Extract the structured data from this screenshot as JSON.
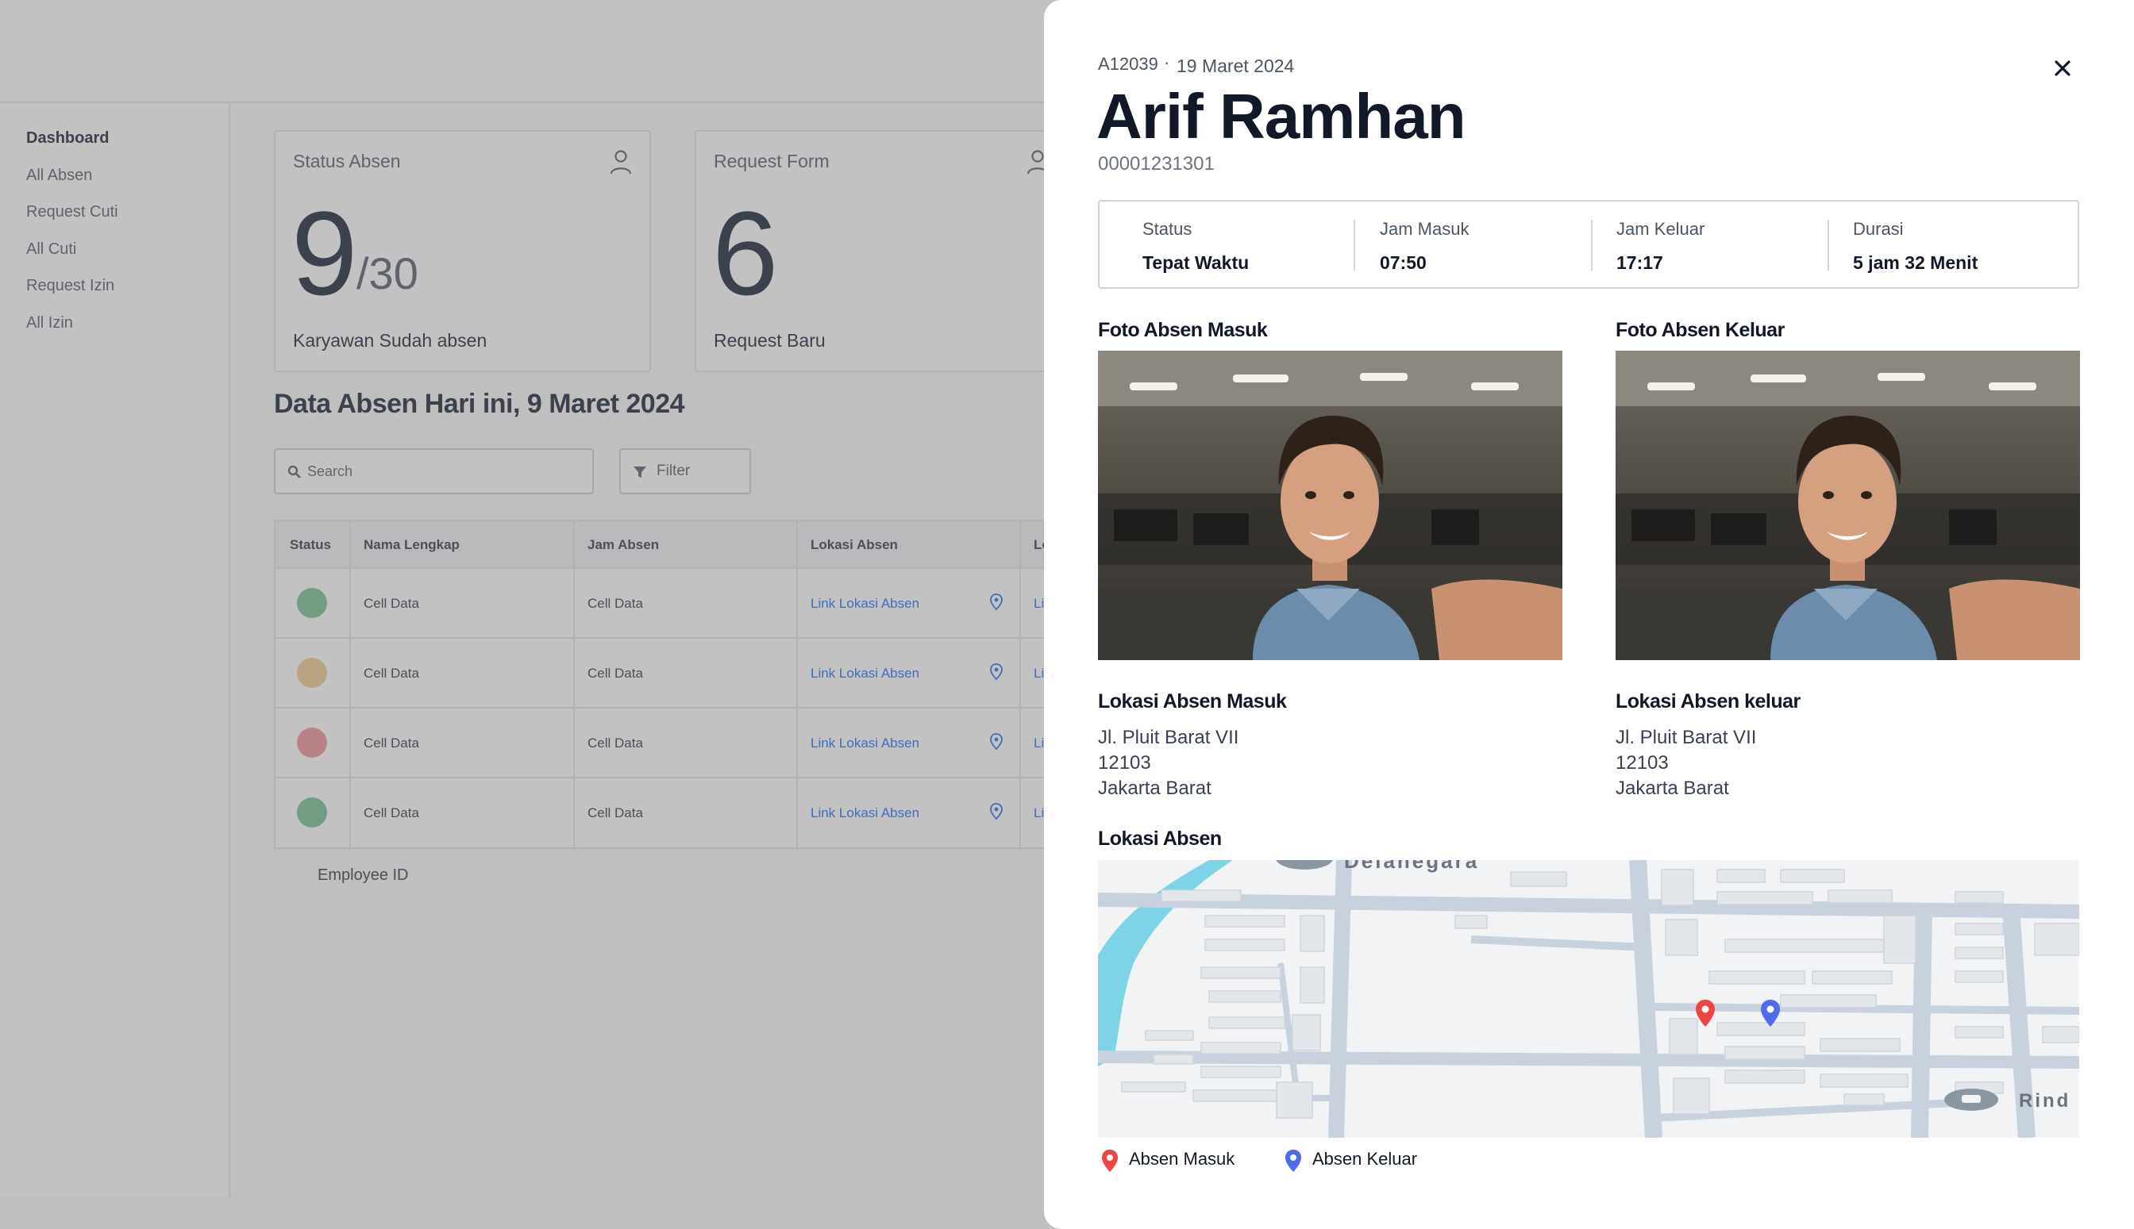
{
  "sidebar": {
    "items": [
      {
        "label": "Dashboard"
      },
      {
        "label": "All Absen"
      },
      {
        "label": "Request Cuti"
      },
      {
        "label": "All Cuti"
      },
      {
        "label": "Request Izin"
      },
      {
        "label": "All Izin"
      }
    ]
  },
  "cards": {
    "status": {
      "title": "Status Absen",
      "value": "9",
      "total": "/30",
      "caption": "Karyawan Sudah absen"
    },
    "request": {
      "title": "Request Form",
      "value": "6",
      "caption": "Request Baru"
    }
  },
  "section_title": "Data Absen Hari ini, 9 Maret 2024",
  "search": {
    "placeholder": "Search"
  },
  "filter_label": "Filter",
  "table": {
    "headers": [
      "Status",
      "Nama Lengkap",
      "Jam Absen",
      "Lokasi Absen",
      "Lo"
    ],
    "rows": [
      {
        "status_color": "#86c8a0",
        "name": "Cell Data",
        "time": "Cell Data",
        "location": "Link Lokasi Absen",
        "extra": "Li"
      },
      {
        "status_color": "#f5d3a0",
        "name": "Cell Data",
        "time": "Cell Data",
        "location": "Link Lokasi Absen",
        "extra": "Li"
      },
      {
        "status_color": "#f0a0a8",
        "name": "Cell Data",
        "time": "Cell Data",
        "location": "Link Lokasi Absen",
        "extra": "Li"
      },
      {
        "status_color": "#86c8a0",
        "name": "Cell Data",
        "time": "Cell Data",
        "location": "Link Lokasi Absen",
        "extra": "Li"
      }
    ],
    "footer": "Employee ID"
  },
  "detail": {
    "code": "A12039",
    "separator": "·",
    "date": "19 Maret 2024",
    "name": "Arif Ramhan",
    "number": "00001231301",
    "stats": [
      {
        "label": "Status",
        "value": "Tepat Waktu"
      },
      {
        "label": "Jam Masuk",
        "value": "07:50"
      },
      {
        "label": "Jam Keluar",
        "value": "17:17"
      },
      {
        "label": "Durasi",
        "value": "5 jam 32 Menit"
      }
    ],
    "photo_in_title": "Foto Absen Masuk",
    "photo_out_title": "Foto Absen Keluar",
    "loc_in": {
      "title": "Lokasi Absen Masuk",
      "street": "Jl. Pluit Barat VII",
      "postal": "12103",
      "city": "Jakarta Barat"
    },
    "loc_out": {
      "title": "Lokasi Absen keluar",
      "street": "Jl. Pluit Barat VII",
      "postal": "12103",
      "city": "Jakarta Barat"
    },
    "map_title": "Lokasi Absen",
    "map_labels": {
      "top": "Delanegara",
      "bottom_right": "Rind"
    },
    "legend": {
      "in": "Absen Masuk",
      "out": "Absen Keluar",
      "in_color": "#ef4444",
      "out_color": "#4f6bed"
    }
  }
}
